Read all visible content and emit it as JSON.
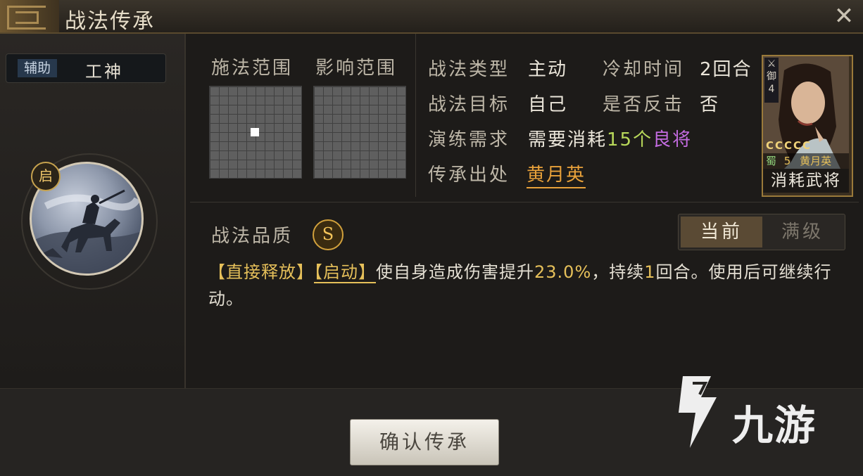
{
  "window": {
    "title": "战法传承",
    "close_icon": "close-icon"
  },
  "skill": {
    "role_tag": "辅助",
    "role_name": "工神",
    "icon_badge": "启"
  },
  "ranges": {
    "cast_label": "施法范围",
    "effect_label": "影响范围"
  },
  "info": {
    "type_label": "战法类型",
    "type_value": "主动",
    "cooldown_label": "冷却时间",
    "cooldown_value": "2回合",
    "target_label": "战法目标",
    "target_value": "自己",
    "counter_label": "是否反击",
    "counter_value": "否",
    "drill_label": "演练需求",
    "drill_prefix": "需要消耗",
    "drill_count": "15个",
    "drill_quality": "良将",
    "source_label": "传承出处",
    "source_value": "黄月英"
  },
  "hero_card": {
    "side_tag": "御",
    "side_level": "4",
    "stars": "CCCCC",
    "faction": "蜀",
    "cost": "5",
    "name": "黄月英",
    "caption": "消耗武将"
  },
  "quality": {
    "label": "战法品质",
    "grade": "S"
  },
  "tabs": {
    "current": "当前",
    "max": "满级"
  },
  "description": {
    "tag1": "【直接释放】",
    "tag2": "【启动】",
    "text_a": "使自身造成伤害提升",
    "value": "23.0%",
    "text_b": "，持续",
    "turns": "1",
    "text_c": "回合。使用后可继续行动。"
  },
  "confirm_button": "确认传承",
  "watermark": "九游",
  "colors": {
    "gold": "#e6c05a",
    "green": "#b8d85a",
    "purple": "#c36be0",
    "orange": "#e8a13a"
  }
}
